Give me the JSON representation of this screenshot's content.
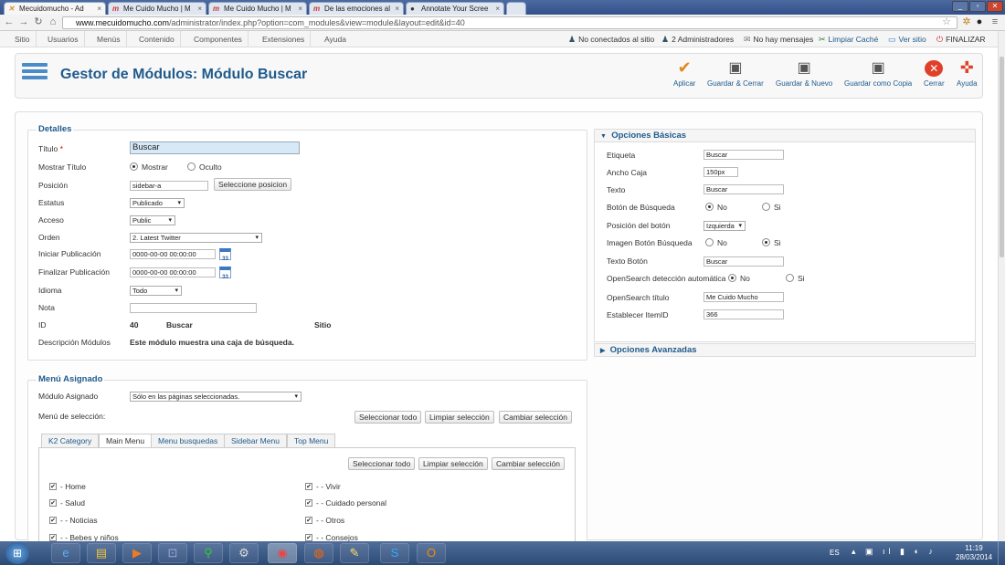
{
  "browser": {
    "tabs": [
      {
        "label": "Mecuidomucho - Ad",
        "icon": "joomla-icon",
        "active": true
      },
      {
        "label": "Me Cuido Mucho | M",
        "icon": "m-icon"
      },
      {
        "label": "Me Cuido Mucho | M",
        "icon": "m-icon"
      },
      {
        "label": "De las emociones al",
        "icon": "m-icon"
      },
      {
        "label": "Annotate Your Scree",
        "icon": "annotate-icon"
      }
    ],
    "url_domain": "www.mecuidomucho.com",
    "url_path": "/administrator/index.php?option=com_modules&view=module&layout=edit&id=40"
  },
  "topmenu": {
    "items": [
      "Sitio",
      "Usuarios",
      "Menús",
      "Contenido",
      "Componentes",
      "Extensiones",
      "Ayuda"
    ],
    "status": {
      "visitors": "No conectados al sitio",
      "admins": "2 Administradores",
      "messages": "No hay mensajes",
      "clear_cache": "Limpiar Caché",
      "view_site": "Ver sitio",
      "logout": "FINALIZAR"
    }
  },
  "header": {
    "title": "Gestor de Módulos: Módulo Buscar",
    "toolbar": {
      "apply": "Aplicar",
      "save_close": "Guardar & Cerrar",
      "save_new": "Guardar & Nuevo",
      "save_copy": "Guardar como Copia",
      "close": "Cerrar",
      "help": "Ayuda"
    },
    "colors": {
      "accent": "#1f5a8c",
      "apply": "#e08a1e",
      "close": "#e0402a"
    }
  },
  "details": {
    "legend": "Detalles",
    "title_label": "Título",
    "title_required": "*",
    "title_value": "Buscar",
    "show_title_label": "Mostrar Título",
    "show_opt": "Mostrar",
    "hide_opt": "Oculto",
    "position_label": "Posición",
    "position_value": "sidebar-a",
    "select_position": "Seleccione posicion",
    "status_label": "Estatus",
    "status_value": "Publicado",
    "access_label": "Acceso",
    "access_value": "Public",
    "order_label": "Orden",
    "order_value": "2. Latest Twitter",
    "start_label": "Iniciar Publicación",
    "start_value": "0000-00-00 00:00:00",
    "end_label": "Finalizar Publicación",
    "end_value": "0000-00-00 00:00:00",
    "calendar_day": "33",
    "language_label": "Idioma",
    "language_value": "Todo",
    "note_label": "Nota",
    "note_value": "",
    "id_label": "ID",
    "id_value": "40",
    "id_module": "Buscar",
    "id_client": "Sitio",
    "desc_label": "Descripción Módulos",
    "desc_value": "Este módulo muestra una caja de búsqueda."
  },
  "assigned": {
    "legend": "Menú Asignado",
    "module_assigned_label": "Módulo Asignado",
    "module_assigned_value": "Sólo en las páginas seleccionadas.",
    "menu_selection_label": "Menú de selección:",
    "select_all": "Seleccionar todo",
    "clear_selection": "Limpiar selección",
    "toggle_selection": "Cambiar selección",
    "tabs": [
      "K2 Category",
      "Main Menu",
      "Menu busquedas",
      "Sidebar Menu",
      "Top Menu"
    ],
    "left_items": [
      "- Home",
      "- Salud",
      "- - Noticias",
      "- - Bebes y niños"
    ],
    "right_items": [
      "- - Vivir",
      "- - Cuidado personal",
      "- - Otros",
      "- - Consejos"
    ]
  },
  "basic": {
    "heading": "Opciones Básicas",
    "label_label": "Etiqueta",
    "label_value": "Buscar",
    "width_label": "Ancho Caja",
    "width_value": "150px",
    "text_label": "Texto",
    "text_value": "Buscar",
    "search_btn_label": "Botón de Búsqueda",
    "no": "No",
    "yes": "Si",
    "btn_pos_label": "Posición del botón",
    "btn_pos_value": "Izquierda",
    "img_btn_label": "Imagen Botón Búsqueda",
    "btn_text_label": "Texto Botón",
    "btn_text_value": "Buscar",
    "opensearch_label": "OpenSearch detección automática",
    "opensearch_title_label": "OpenSearch título",
    "opensearch_title_value": "Me Cuido Mucho",
    "itemid_label": "Establecer ItemID",
    "itemid_value": "366"
  },
  "advanced": {
    "heading": "Opciones Avanzadas"
  },
  "taskbar": {
    "lang": "ES",
    "time": "11:19",
    "date": "28/03/2014"
  }
}
